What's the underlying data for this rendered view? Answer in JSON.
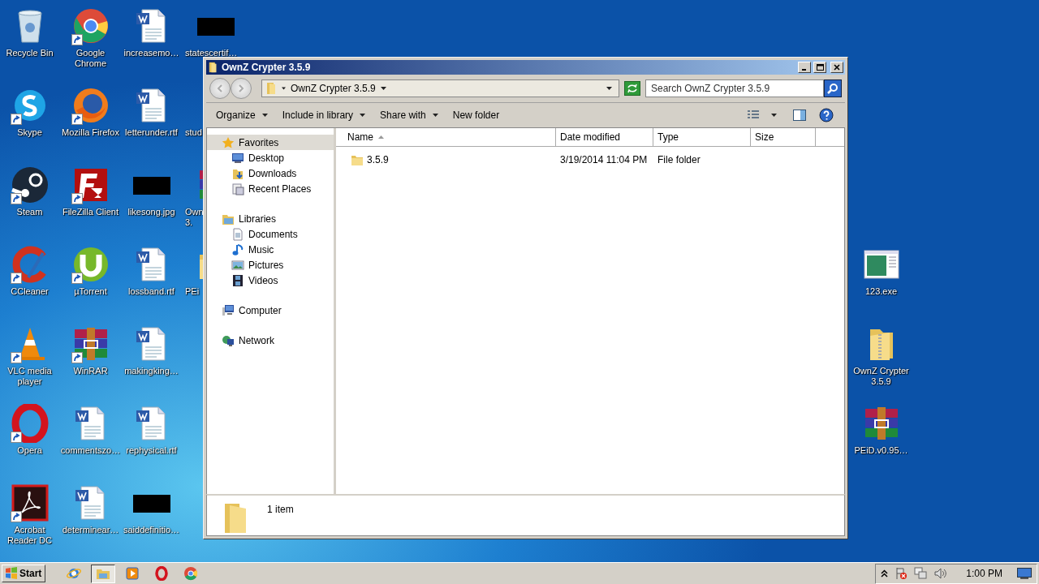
{
  "desktop": {
    "columns": [
      [
        {
          "label": "Recycle Bin",
          "kind": "recycle",
          "shortcut": false
        },
        {
          "label": "Skype",
          "kind": "skype",
          "shortcut": true
        },
        {
          "label": "Steam",
          "kind": "steam",
          "shortcut": true
        },
        {
          "label": "CCleaner",
          "kind": "ccleaner",
          "shortcut": true
        },
        {
          "label": "VLC media player",
          "kind": "vlc",
          "shortcut": true
        },
        {
          "label": "Opera",
          "kind": "opera",
          "shortcut": true
        },
        {
          "label": "Acrobat Reader DC",
          "kind": "acrobat",
          "shortcut": true
        }
      ],
      [
        {
          "label": "Google Chrome",
          "kind": "chrome",
          "shortcut": true
        },
        {
          "label": "Mozilla Firefox",
          "kind": "firefox",
          "shortcut": true
        },
        {
          "label": "FileZilla Client",
          "kind": "filezilla",
          "shortcut": true
        },
        {
          "label": "µTorrent",
          "kind": "utorrent",
          "shortcut": true
        },
        {
          "label": "WinRAR",
          "kind": "winrar",
          "shortcut": true
        },
        {
          "label": "commentszo…",
          "kind": "word",
          "shortcut": false
        },
        {
          "label": "determinear…",
          "kind": "word",
          "shortcut": false
        }
      ],
      [
        {
          "label": "increasemo…",
          "kind": "word",
          "shortcut": false
        },
        {
          "label": "letterunder.rtf",
          "kind": "word",
          "shortcut": false
        },
        {
          "label": "likesong.jpg",
          "kind": "redacted",
          "shortcut": false
        },
        {
          "label": "lossband.rtf",
          "kind": "word",
          "shortcut": false
        },
        {
          "label": "makingking…",
          "kind": "word",
          "shortcut": false
        },
        {
          "label": "rephysical.rtf",
          "kind": "word",
          "shortcut": false
        },
        {
          "label": "saiddefinitio…",
          "kind": "redacted",
          "shortcut": false
        }
      ],
      [
        {
          "label": "statescertif…",
          "kind": "redacted",
          "shortcut": false
        },
        {
          "label": "stud",
          "shortcut": false
        },
        {
          "label": "Own 3.",
          "kind": "winrar",
          "shortcut": false
        },
        {
          "label": "PEi",
          "kind": "folder",
          "shortcut": false
        }
      ]
    ],
    "right_column": [
      {
        "label": "123.exe",
        "kind": "exe",
        "shortcut": false
      },
      {
        "label": "OwnZ Crypter 3.5.9",
        "kind": "zipfolder",
        "shortcut": false
      },
      {
        "label": "PEiD.v0.95…",
        "kind": "winrar",
        "shortcut": false
      }
    ]
  },
  "window": {
    "title": "OwnZ Crypter 3.5.9",
    "back": {
      "disabled": true
    },
    "forward": {
      "disabled": true
    },
    "address": "OwnZ Crypter 3.5.9",
    "search": {
      "placeholder": "Search OwnZ Crypter 3.5.9"
    },
    "toolbar": [
      {
        "label": "Organize",
        "has_menu": true
      },
      {
        "label": "Include in library",
        "has_menu": true
      },
      {
        "label": "Share with",
        "has_menu": true
      },
      {
        "label": "New folder",
        "has_menu": false
      }
    ],
    "nav": [
      {
        "label": "Favorites",
        "kind": "star",
        "selected": true,
        "children": [
          {
            "label": "Desktop",
            "kind": "desktop",
            "selected": false
          },
          {
            "label": "Downloads",
            "kind": "downloads",
            "selected": false
          },
          {
            "label": "Recent Places",
            "kind": "recent",
            "selected": false
          }
        ]
      },
      {
        "label": "Libraries",
        "kind": "library",
        "selected": false,
        "children": [
          {
            "label": "Documents",
            "kind": "document",
            "selected": false
          },
          {
            "label": "Music",
            "kind": "music",
            "selected": false
          },
          {
            "label": "Pictures",
            "kind": "pictures",
            "selected": false
          },
          {
            "label": "Videos",
            "kind": "videos",
            "selected": false
          }
        ]
      },
      {
        "label": "Computer",
        "kind": "computer",
        "selected": false
      },
      {
        "label": "Network",
        "kind": "network",
        "selected": false
      }
    ],
    "columns": [
      {
        "label": "Name",
        "sorted": true
      },
      {
        "label": "Date modified",
        "sorted": false
      },
      {
        "label": "Type",
        "sorted": false
      },
      {
        "label": "Size",
        "sorted": false
      }
    ],
    "rows": [
      {
        "name": "3.5.9",
        "kind": "folder",
        "date_modified": "3/19/2014 11:04 PM",
        "type": "File folder"
      }
    ],
    "status": "1 item"
  },
  "taskbar": {
    "start": "Start",
    "apps": [
      {
        "kind": "ie",
        "selected": false
      },
      {
        "kind": "explorer",
        "selected": true
      },
      {
        "kind": "media",
        "selected": false
      },
      {
        "kind": "opera",
        "selected": false
      },
      {
        "kind": "chrome",
        "selected": false
      }
    ],
    "clock": "1:00 PM"
  }
}
